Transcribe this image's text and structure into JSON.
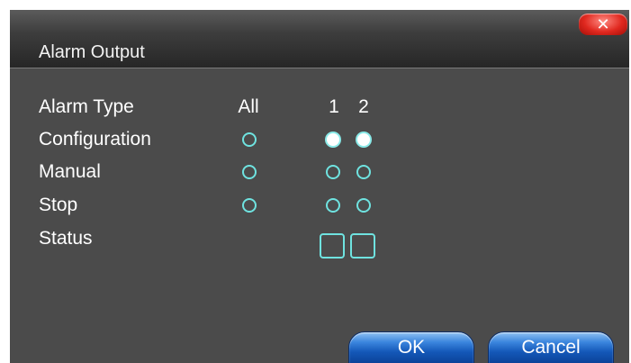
{
  "dialog": {
    "title": "Alarm Output",
    "close_symbol": "✕"
  },
  "columns": {
    "all": "All",
    "ch1": "1",
    "ch2": "2"
  },
  "rows": {
    "alarm_type": "Alarm Type",
    "configuration": "Configuration",
    "manual": "Manual",
    "stop": "Stop",
    "status": "Status"
  },
  "selection": {
    "all": null,
    "channel_1": "Configuration",
    "channel_2": "Configuration"
  },
  "buttons": {
    "ok": "OK",
    "cancel": "Cancel"
  },
  "colors": {
    "accent_cyan": "#6fe3e0",
    "button_blue": "#1458b8",
    "close_red": "#e0281f",
    "panel_gray": "#4b4b4b"
  }
}
